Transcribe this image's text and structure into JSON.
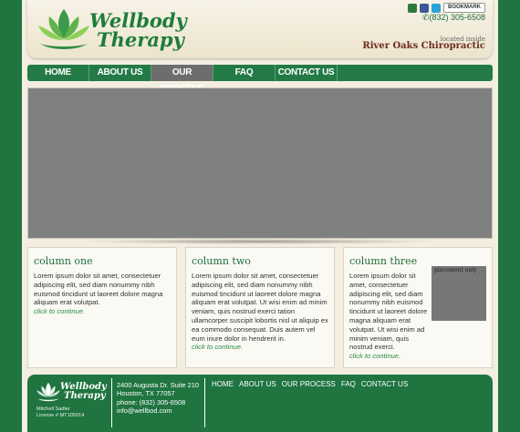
{
  "brand": {
    "line1": "Wellbody",
    "line2": "Therapy",
    "located": "located inside",
    "partner": "River Oaks Chiropractic",
    "phone": "(832) 305-6508",
    "bookmark_label": "BOOKMARK",
    "accent": "#1f7440"
  },
  "icons": [
    "mail-icon",
    "facebook-icon",
    "twitter-icon",
    "phone-icon"
  ],
  "nav": {
    "items": [
      {
        "label": "HOME"
      },
      {
        "label": "ABOUT US"
      },
      {
        "label": "OUR PROCESS"
      },
      {
        "label": "FAQ"
      },
      {
        "label": "CONTACT US"
      }
    ],
    "active_index": 2
  },
  "columns": [
    {
      "title": "column one",
      "body": "Lorem ipsum dolor sit amet, consectetuer adipiscing elit, sed diam nonummy nibh euismod tincidunt ut laoreet dolore magna aliquam erat volutpat.",
      "link": "click to continue."
    },
    {
      "title": "column two",
      "body": "Lorem ipsum dolor sit amet, consectetuer adipiscing elit, sed diam nonummy nibh euismod tincidunt ut laoreet dolore magna aliquam erat volutpat. Ut wisi enim ad minim veniam, quis nostrud exerci tation ullamcorper suscipit lobortis nisl ut aliquip ex ea commodo consequat. Duis autem vel eum iriure dolor in hendrerit in.",
      "link": "click to continue."
    },
    {
      "title": "column three",
      "body": "Lorem ipsum dolor sit amet, consectetuer adipiscing elit, sed diam nonummy nibh euismod tincidunt ut laoreet dolore magna aliquam erat volutpat. Ut wisi enim ad minim veniam, quis nostrud exerci.",
      "link": "click to continue.",
      "placeholder": "placement only"
    }
  ],
  "footer": {
    "logo_line1": "Wellbody",
    "logo_line2": "Therapy",
    "person": "Mitchell Sadler",
    "license": "License # MT105014",
    "address1": "2400 Augusta Dr. Suite 210",
    "address2": "Houston, TX 77057",
    "phone": "phone: (832) 305-6508",
    "email": "info@wellbod.com",
    "links": [
      "HOME",
      "ABOUT US",
      "OUR PROCESS",
      "FAQ",
      "CONTACT US"
    ]
  }
}
